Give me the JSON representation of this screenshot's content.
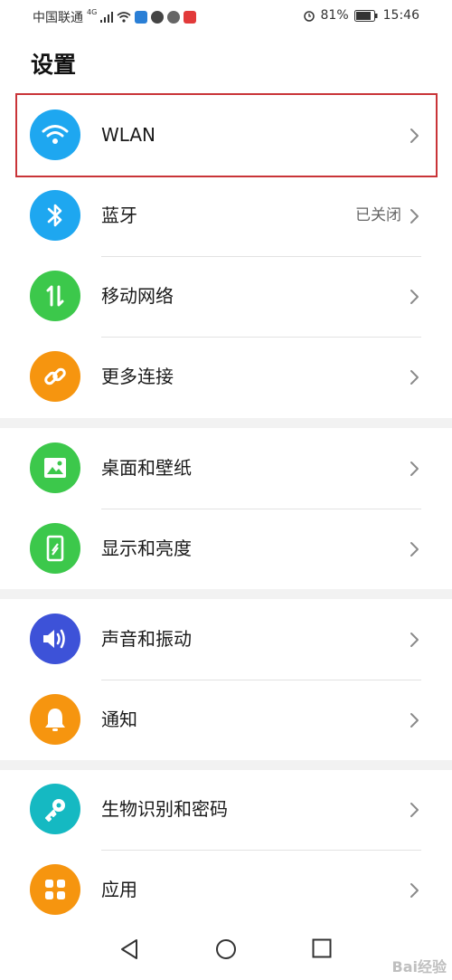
{
  "status_bar": {
    "carrier": "中国联通",
    "network": "4G",
    "battery": "81%",
    "time": "15:46"
  },
  "page": {
    "title": "设置"
  },
  "settings": [
    {
      "label": "WLAN",
      "value": "",
      "icon": "wifi-icon",
      "color": "#1ea7f0"
    },
    {
      "label": "蓝牙",
      "value": "已关闭",
      "icon": "bluetooth-icon",
      "color": "#1ea7f0"
    },
    {
      "label": "移动网络",
      "value": "",
      "icon": "mobile-data-icon",
      "color": "#3cc84b"
    },
    {
      "label": "更多连接",
      "value": "",
      "icon": "link-icon",
      "color": "#f6950f"
    },
    {
      "label": "桌面和壁纸",
      "value": "",
      "icon": "wallpaper-icon",
      "color": "#3cc84b"
    },
    {
      "label": "显示和亮度",
      "value": "",
      "icon": "display-icon",
      "color": "#3cc84b"
    },
    {
      "label": "声音和振动",
      "value": "",
      "icon": "sound-icon",
      "color": "#3d52d8"
    },
    {
      "label": "通知",
      "value": "",
      "icon": "bell-icon",
      "color": "#f6950f"
    },
    {
      "label": "生物识别和密码",
      "value": "",
      "icon": "key-icon",
      "color": "#15b9c2"
    },
    {
      "label": "应用",
      "value": "",
      "icon": "apps-icon",
      "color": "#f6950f"
    }
  ],
  "watermark": "Bai经验"
}
